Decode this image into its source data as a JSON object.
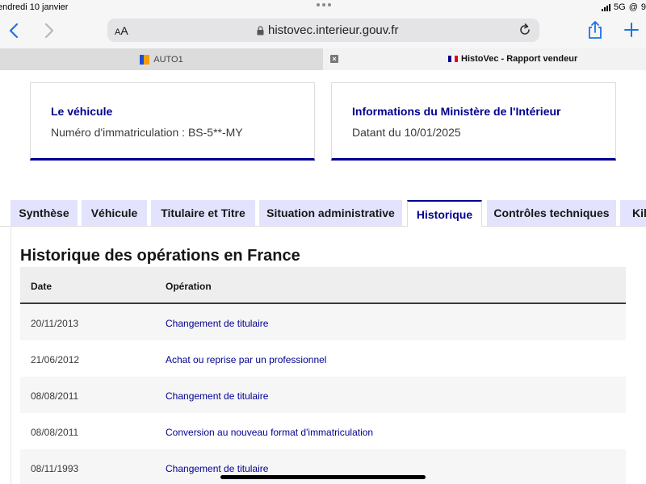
{
  "status_bar": {
    "date": "endredi 10 janvier",
    "network": "5G",
    "battery_partial": "9"
  },
  "browser": {
    "text_size_label": "AA",
    "url": "histovec.interieur.gouv.fr",
    "tabs": [
      {
        "label": "AUTO1"
      },
      {
        "label": "HistoVec - Rapport vendeur"
      }
    ],
    "accent_color": "#1a73e8"
  },
  "cards": [
    {
      "title": "Le véhicule",
      "text": "Numéro d'immatriculation : BS-5**-MY"
    },
    {
      "title": "Informations du Ministère de l'Intérieur",
      "text": "Datant du 10/01/2025"
    }
  ],
  "page_tabs": [
    {
      "label": "Synthèse"
    },
    {
      "label": "Véhicule"
    },
    {
      "label": "Titulaire et Titre"
    },
    {
      "label": "Situation administrative"
    },
    {
      "label": "Historique",
      "active": true
    },
    {
      "label": "Contrôles techniques"
    },
    {
      "label": "Kil"
    }
  ],
  "history": {
    "title": "Historique des opérations en France",
    "columns": [
      "Date",
      "Opération"
    ],
    "rows": [
      {
        "date": "20/11/2013",
        "operation": "Changement de titulaire"
      },
      {
        "date": "21/06/2012",
        "operation": "Achat ou reprise par un professionnel"
      },
      {
        "date": "08/08/2011",
        "operation": "Changement de titulaire"
      },
      {
        "date": "08/08/2011",
        "operation": "Conversion au nouveau format d'immatriculation"
      },
      {
        "date": "08/11/1993",
        "operation": "Changement de titulaire"
      }
    ]
  },
  "colors": {
    "brand_blue": "#000091",
    "tab_background": "#e3e3fd"
  }
}
